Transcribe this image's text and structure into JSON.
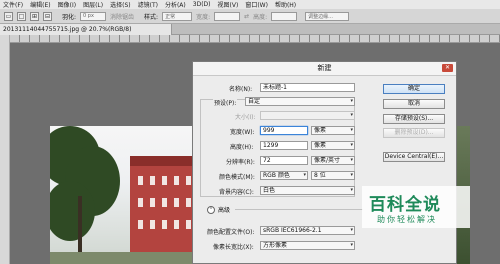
{
  "menu": [
    "文件(F)",
    "编辑(E)",
    "图像(I)",
    "图层(L)",
    "选择(S)",
    "滤镜(T)",
    "分析(A)",
    "3D(D)",
    "视图(V)",
    "窗口(W)",
    "帮助(H)"
  ],
  "options": {
    "feather_label": "羽化:",
    "feather_value": "0 px",
    "antialias_label": "消除锯齿",
    "style_label": "样式:",
    "style_value": "正常",
    "width_label": "宽度:",
    "height_label": "高度:",
    "refine_edge": "调整边缘..."
  },
  "document_tab": "20131114044755715.jpg @ 20.7%(RGB/8)",
  "dialog": {
    "title": "新建",
    "name_label": "名称(N):",
    "name_value": "未标题-1",
    "preset_label": "预设(P):",
    "preset_value": "自定",
    "size_label": "大小(I):",
    "width_label": "宽度(W):",
    "width_value": "999",
    "width_unit": "像素",
    "height_label": "高度(H):",
    "height_value": "1299",
    "height_unit": "像素",
    "resolution_label": "分辨率(R):",
    "resolution_value": "72",
    "resolution_unit": "像素/英寸",
    "color_mode_label": "颜色模式(M):",
    "color_mode_value": "RGB 颜色",
    "bit_depth_value": "8 位",
    "background_label": "背景内容(C):",
    "background_value": "白色",
    "advanced_label": "高级",
    "color_profile_label": "颜色配置文件(O):",
    "color_profile_value": "sRGB IEC61966-2.1",
    "pixel_aspect_label": "像素长宽比(X):",
    "pixel_aspect_value": "方形像素",
    "buttons": {
      "ok": "确定",
      "cancel": "取消",
      "save_preset": "存储预设(S)...",
      "delete_preset": "删除预设(D)...",
      "device_central": "Device Central(E)..."
    }
  },
  "watermark": {
    "title": "百科全说",
    "subtitle": "助你轻松解决"
  },
  "colors": {
    "focus": "#3b84d9",
    "close": "#c84a3a",
    "watermark": "#1f8a5a"
  }
}
